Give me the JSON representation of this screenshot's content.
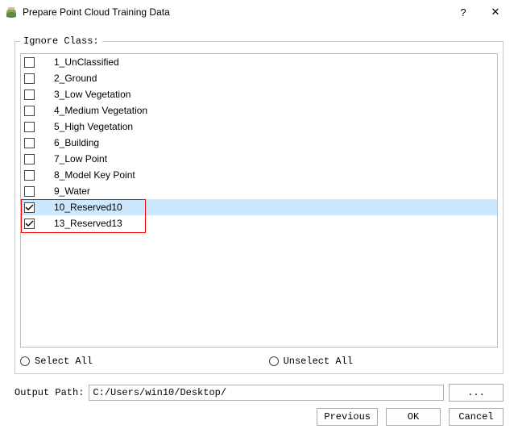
{
  "window": {
    "title": "Prepare Point Cloud Training Data",
    "help_symbol": "?",
    "close_symbol": "✕"
  },
  "group": {
    "legend": "Ignore Class:"
  },
  "classes": [
    {
      "label": "1_UnClassified",
      "checked": false,
      "selected": false
    },
    {
      "label": "2_Ground",
      "checked": false,
      "selected": false
    },
    {
      "label": "3_Low Vegetation",
      "checked": false,
      "selected": false
    },
    {
      "label": "4_Medium Vegetation",
      "checked": false,
      "selected": false
    },
    {
      "label": "5_High Vegetation",
      "checked": false,
      "selected": false
    },
    {
      "label": "6_Building",
      "checked": false,
      "selected": false
    },
    {
      "label": "7_Low Point",
      "checked": false,
      "selected": false
    },
    {
      "label": "8_Model Key Point",
      "checked": false,
      "selected": false
    },
    {
      "label": "9_Water",
      "checked": false,
      "selected": false
    },
    {
      "label": "10_Reserved10",
      "checked": true,
      "selected": true
    },
    {
      "label": "13_Reserved13",
      "checked": true,
      "selected": false
    }
  ],
  "radios": {
    "select_all": "Select All",
    "unselect_all": "Unselect All"
  },
  "output": {
    "label": "Output Path:",
    "value": "C:/Users/win10/Desktop/",
    "browse": "..."
  },
  "buttons": {
    "previous": "Previous",
    "ok": "OK",
    "cancel": "Cancel"
  }
}
